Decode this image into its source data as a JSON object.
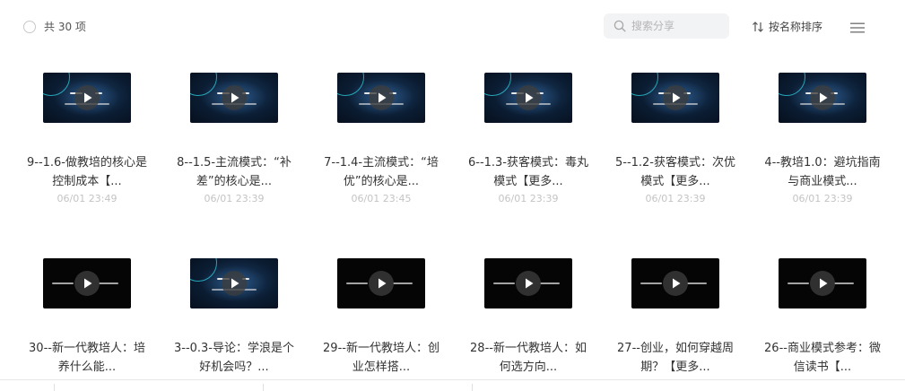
{
  "toolbar": {
    "count_label": "共 30 项",
    "search_placeholder": "搜索分享",
    "sort_label": "按名称排序"
  },
  "icons": {
    "select": "circle-checkbox-icon",
    "search": "search-icon",
    "sort": "sort-arrows-icon",
    "menu": "hamburger-menu-icon",
    "play": "play-icon"
  },
  "colors": {
    "thumb_blue_bg": "#0b1d33",
    "thumb_ring": "#2fd3e4",
    "date_text": "#c4c4c4",
    "search_bg": "#f2f3f5"
  },
  "items": [
    {
      "title": "9--1.6-做教培的核心是控制成本【...",
      "date": "06/01 23:49",
      "style": "blue"
    },
    {
      "title": "8--1.5-主流模式：“补差”的核心是...",
      "date": "06/01 23:39",
      "style": "blue"
    },
    {
      "title": "7--1.4-主流模式：“培优”的核心是...",
      "date": "06/01 23:45",
      "style": "blue"
    },
    {
      "title": "6--1.3-获客模式：毒丸模式【更多...",
      "date": "06/01 23:39",
      "style": "blue"
    },
    {
      "title": "5--1.2-获客模式：次优模式【更多...",
      "date": "06/01 23:39",
      "style": "blue"
    },
    {
      "title": "4--教培1.0：避坑指南与商业模式...",
      "date": "06/01 23:39",
      "style": "blue"
    },
    {
      "title": "30--新一代教培人：培养什么能...",
      "date": "",
      "style": "black"
    },
    {
      "title": "3--0.3-导论：学浪是个好机会吗？...",
      "date": "",
      "style": "blue"
    },
    {
      "title": "29--新一代教培人：创业怎样搭...",
      "date": "",
      "style": "black"
    },
    {
      "title": "28--新一代教培人：如何选方向...",
      "date": "",
      "style": "black"
    },
    {
      "title": "27--创业，如何穿越周期？【更多...",
      "date": "",
      "style": "black"
    },
    {
      "title": "26--商业模式参考：微信读书【...",
      "date": "",
      "style": "black"
    }
  ]
}
